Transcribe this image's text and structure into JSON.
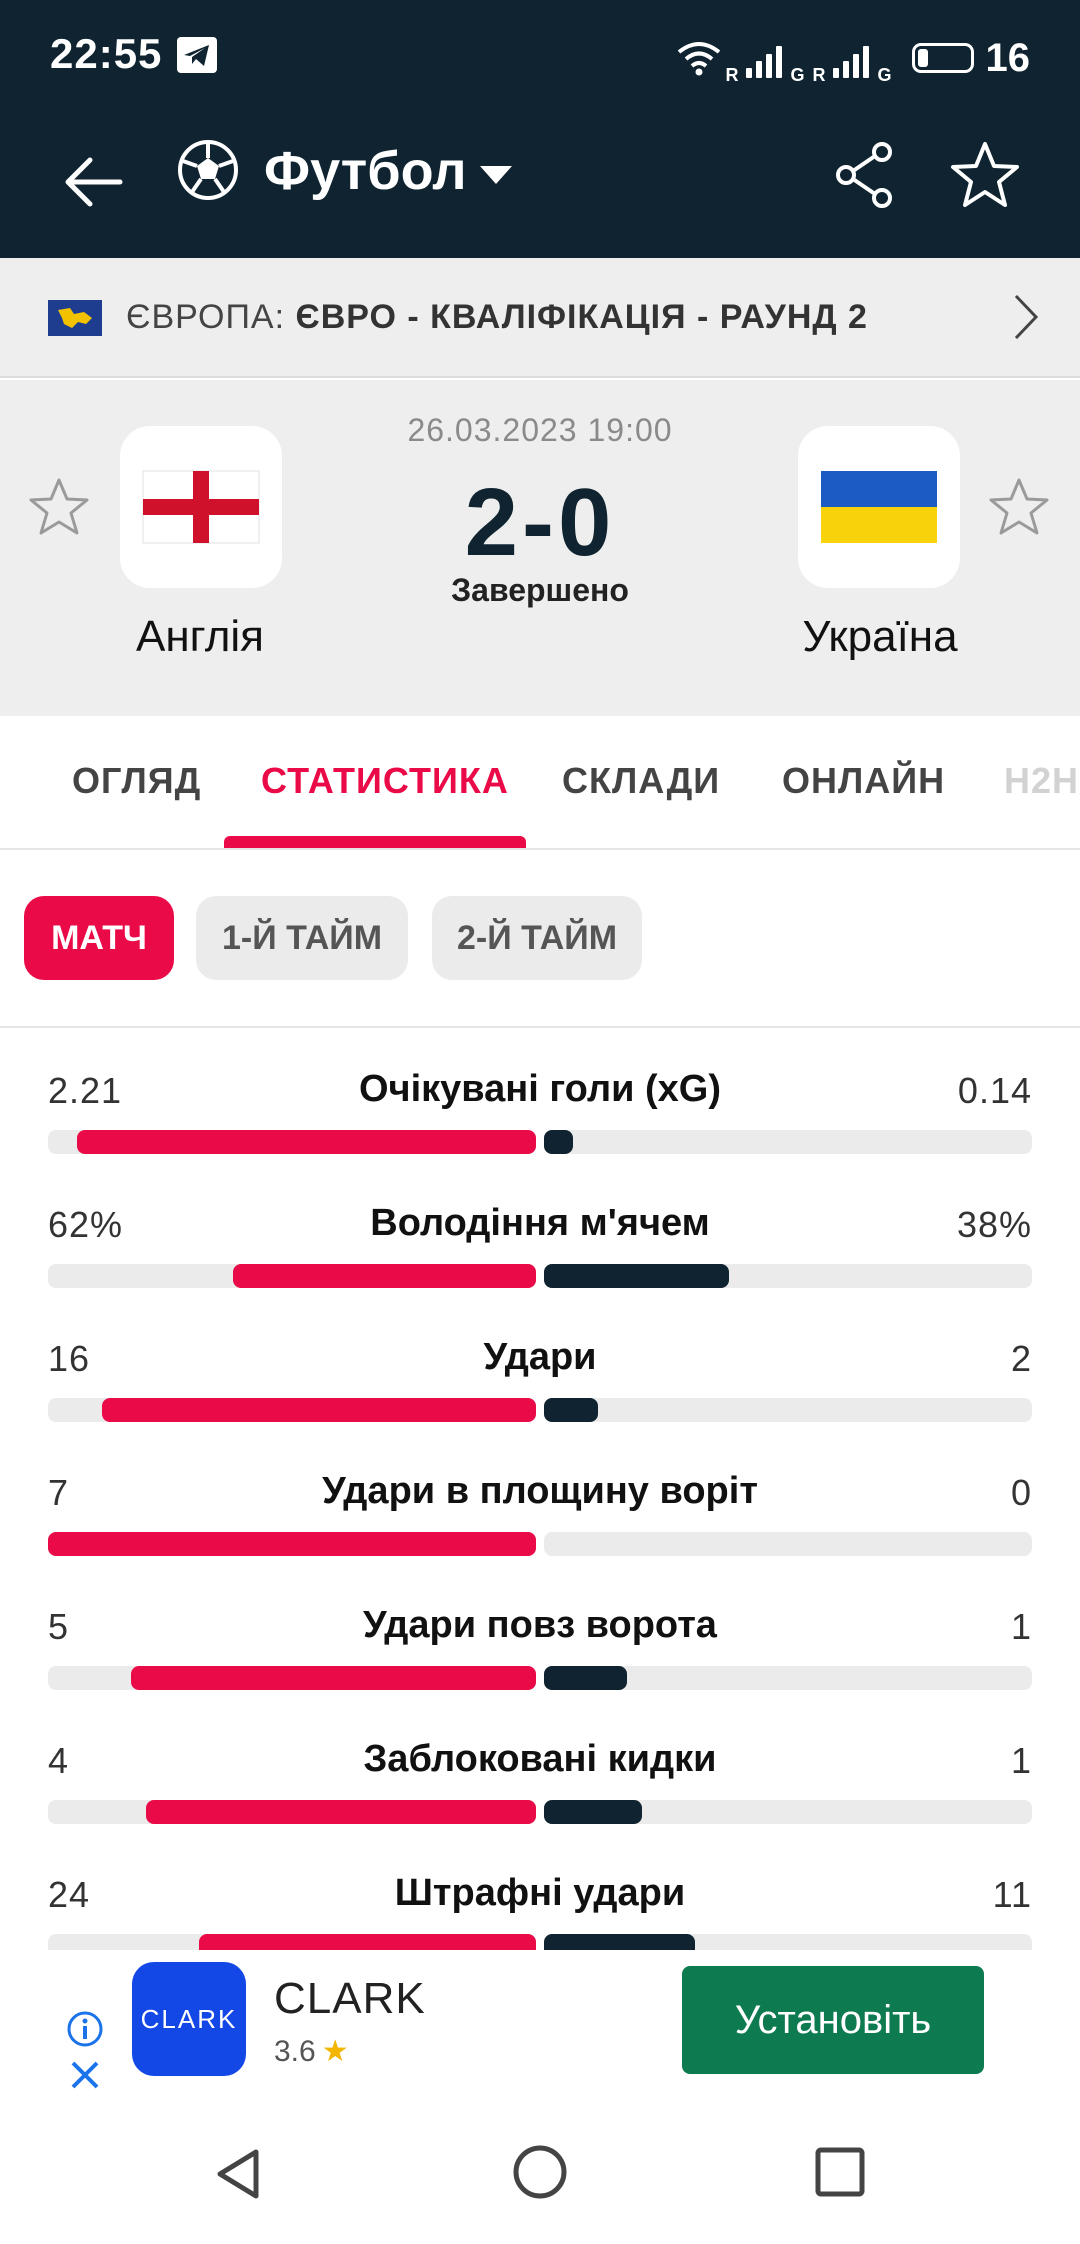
{
  "status_bar": {
    "time": "22:55",
    "signal_1_label": "R",
    "signal_1_network": "G",
    "signal_2_label": "R",
    "signal_2_network": "G",
    "battery_level": "16"
  },
  "toolbar": {
    "sport": "Футбол"
  },
  "competition": {
    "region": "ЄВРОПА: ",
    "name": "ЄВРО - КВАЛІФІКАЦІЯ - РАУНД 2"
  },
  "match": {
    "date": "26.03.2023 19:00",
    "score": "2-0",
    "status": "Завершено",
    "home_team": "Англія",
    "away_team": "Україна"
  },
  "tabs": [
    {
      "label": "ОГЛЯД"
    },
    {
      "label": "СТАТИСТИКА"
    },
    {
      "label": "СКЛАДИ"
    },
    {
      "label": "ОНЛАЙН"
    },
    {
      "label": "H2H"
    }
  ],
  "periods": [
    {
      "label": "МАТЧ"
    },
    {
      "label": "1-Й ТАЙМ"
    },
    {
      "label": "2-Й ТАЙМ"
    }
  ],
  "stats": [
    {
      "label": "Очікувані голи (xG)",
      "home": "2.21",
      "away": "0.14",
      "home_share": 0.94,
      "away_share": 0.06
    },
    {
      "label": "Володіння м'ячем",
      "home": "62%",
      "away": "38%",
      "home_share": 0.62,
      "away_share": 0.38
    },
    {
      "label": "Удари",
      "home": "16",
      "away": "2",
      "home_share": 0.89,
      "away_share": 0.11
    },
    {
      "label": "Удари в площину воріт",
      "home": "7",
      "away": "0",
      "home_share": 1.0,
      "away_share": 0.0
    },
    {
      "label": "Удари повз ворота",
      "home": "5",
      "away": "1",
      "home_share": 0.83,
      "away_share": 0.17
    },
    {
      "label": "Заблоковані кидки",
      "home": "4",
      "away": "1",
      "home_share": 0.8,
      "away_share": 0.2
    },
    {
      "label": "Штрафні удари",
      "home": "24",
      "away": "11",
      "home_share": 0.69,
      "away_share": 0.31
    }
  ],
  "ad": {
    "logo_text": "CLARK",
    "name": "CLARK",
    "rating": "3.6",
    "install_label": "Установіть"
  },
  "colors": {
    "header_bg": "#0f2430",
    "accent": "#ea0a47",
    "away_bar": "#0f2430",
    "install_button": "#0d7b4f"
  }
}
